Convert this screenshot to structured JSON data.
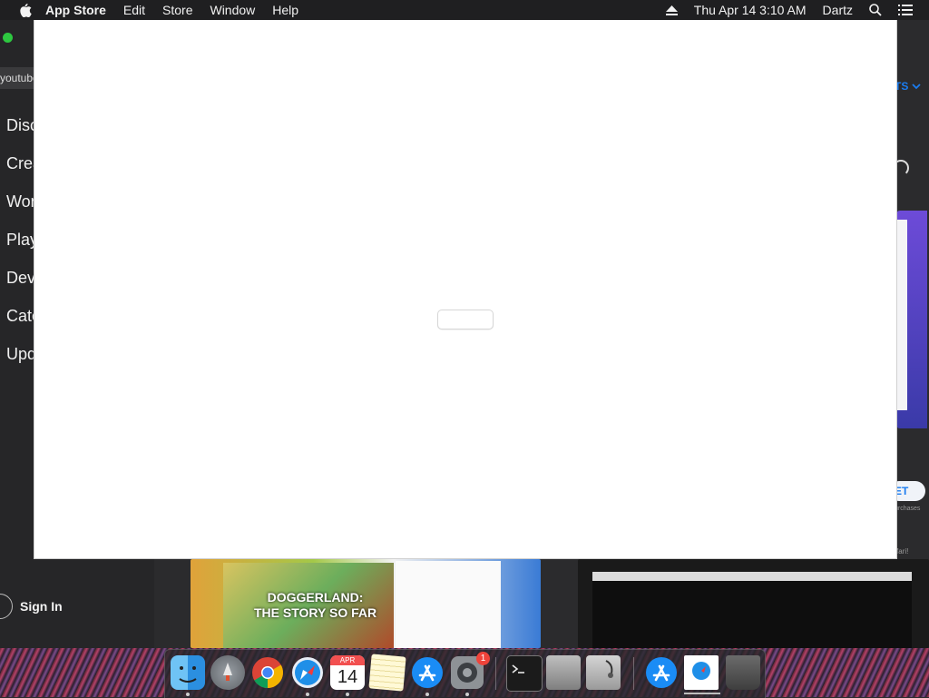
{
  "menubar": {
    "app_name": "App Store",
    "items": [
      "Edit",
      "Store",
      "Window",
      "Help"
    ],
    "datetime": "Thu Apr 14  3:10 AM",
    "user": "Dartz"
  },
  "sidebar": {
    "search_value": "youtube",
    "items": [
      "Disc",
      "Crea",
      "Wor",
      "Play",
      "Dev",
      "Cate",
      "Upd"
    ],
    "sign_in": "Sign In"
  },
  "right_panel": {
    "dropdown_fragment": "TS",
    "get_fragment": "ET",
    "purchases_fragment": "urchases",
    "safari_fragment": "fari!"
  },
  "previews": {
    "left_caption_line1": "DOGGERLAND:",
    "left_caption_line2": "THE STORY SO FAR"
  },
  "dock": {
    "calendar_month": "APR",
    "calendar_day": "14",
    "badge_count": "1",
    "items": [
      "Finder",
      "Launchpad",
      "Chrome",
      "Safari",
      "Calendar",
      "Notes",
      "App Store",
      "System Preferences",
      "Terminal",
      "Boot Camp Assistant",
      "Disk Utility",
      "App Store",
      "Downloads",
      "Trash"
    ]
  }
}
